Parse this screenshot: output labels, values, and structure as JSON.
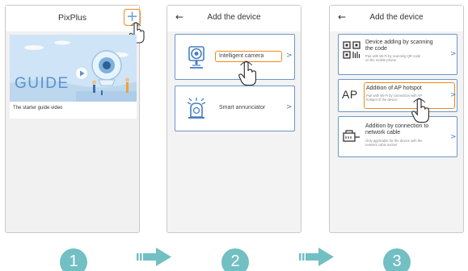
{
  "colors": {
    "accent_highlight": "#f08a1c",
    "card_border": "#6c97c9",
    "icon_blue": "#4a7fc0",
    "step_teal": "#72bfc4"
  },
  "screen1": {
    "title": "PixPlus",
    "add_icon": "plus-icon",
    "add_glyph": "+",
    "guide_image_text": "GUIDE",
    "guide_caption": "The starter guide video"
  },
  "screen2": {
    "back_glyph": "←",
    "title": "Add the device",
    "items": [
      {
        "label": "Intelligent camera",
        "icon": "camera-icon",
        "highlighted": true
      },
      {
        "label": "Smart annunciator",
        "icon": "annunciator-icon",
        "highlighted": false
      }
    ],
    "chevron": ">"
  },
  "screen3": {
    "back_glyph": "←",
    "title": "Add the device",
    "options": [
      {
        "title_line1": "Device adding by scanning",
        "title_line2": "the code",
        "sub_line1": "Pair with Wi-Fi by scanning QR code",
        "sub_line2": "on the mobile phone",
        "icon": "qr-code-icon",
        "highlighted": false
      },
      {
        "icon_text": "AP",
        "title_line1": "Addition of AP hotspot",
        "sub_line1": "Pair with Wi-Fi by connection with AP",
        "sub_line2": "hotspot of the device",
        "icon": "ap-hotspot-icon",
        "highlighted": true
      },
      {
        "title_line1": "Addition by connection to",
        "title_line2": "network cable",
        "sub_line1": "Only applicable for the device with the",
        "sub_line2": "network cable socket",
        "icon": "network-cable-icon",
        "highlighted": false
      }
    ],
    "chevron": ">"
  },
  "steps": [
    "1",
    "2",
    "3"
  ]
}
